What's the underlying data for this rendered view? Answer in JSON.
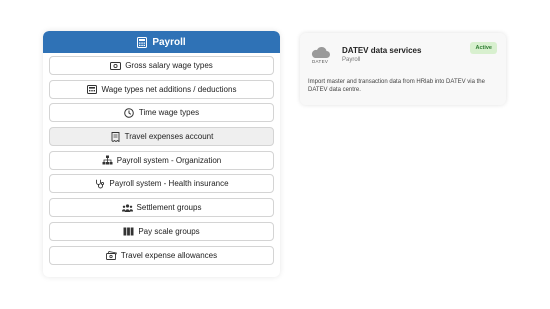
{
  "panel": {
    "title": "Payroll",
    "items": [
      {
        "label": "Gross salary wage types",
        "icon": "money-icon"
      },
      {
        "label": "Wage types net additions / deductions",
        "icon": "calculator-icon"
      },
      {
        "label": "Time wage types",
        "icon": "clock-icon"
      },
      {
        "label": "Travel expenses account",
        "icon": "receipt-icon",
        "selected": true
      },
      {
        "label": "Payroll system - Organization",
        "icon": "org-chart-icon"
      },
      {
        "label": "Payroll system - Health insurance",
        "icon": "stethoscope-icon"
      },
      {
        "label": "Settlement groups",
        "icon": "users-icon"
      },
      {
        "label": "Pay scale groups",
        "icon": "columns-icon"
      },
      {
        "label": "Travel expense allowances",
        "icon": "cash-icon"
      }
    ]
  },
  "card": {
    "title": "DATEV data services",
    "subtitle": "Payroll",
    "badge": "Active",
    "logo_text": "DATEV",
    "description": "Import master and transaction data from HRlab into DATEV via the DATEV data centre."
  },
  "colors": {
    "header": "#2f72b6",
    "badge_bg": "#d8f0cf",
    "badge_text": "#2e7d32"
  }
}
